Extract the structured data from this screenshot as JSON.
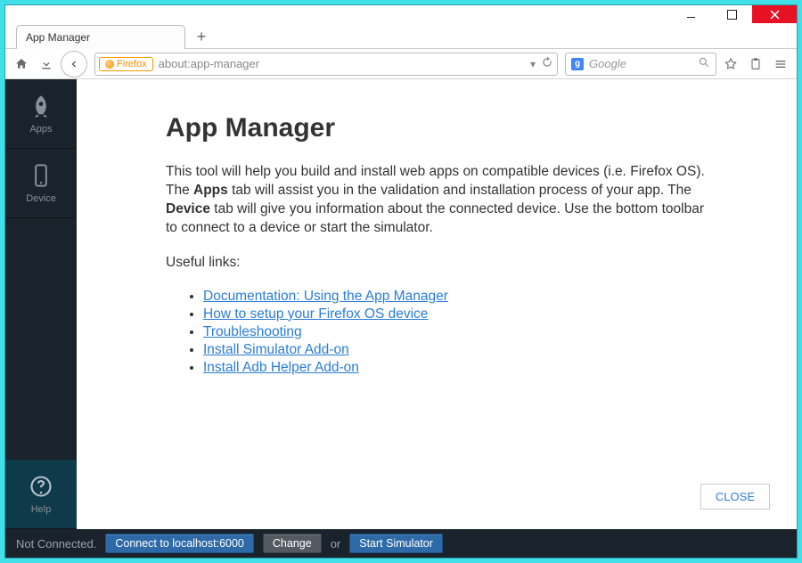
{
  "tab": {
    "title": "App Manager"
  },
  "url": {
    "identity": "Firefox",
    "address": "about:app-manager"
  },
  "search": {
    "placeholder": "Google"
  },
  "sidebar": {
    "apps": "Apps",
    "device": "Device",
    "help": "Help"
  },
  "page": {
    "title": "App Manager",
    "intro_1": "This tool will help you build and install web apps on compatible devices (i.e. Firefox OS). The ",
    "intro_apps": "Apps",
    "intro_2": " tab will assist you in the validation and installation process of your app. The ",
    "intro_device": "Device",
    "intro_3": " tab will give you information about the connected device. Use the bottom toolbar to connect to a device or start the simulator.",
    "useful": "Useful links:",
    "links": [
      "Documentation: Using the App Manager",
      "How to setup your Firefox OS device",
      "Troubleshooting",
      "Install Simulator Add-on",
      "Install Adb Helper Add-on"
    ],
    "close": "CLOSE"
  },
  "status": {
    "state": "Not Connected.",
    "connect": "Connect to localhost:6000",
    "change": "Change",
    "or": "or",
    "start": "Start Simulator"
  }
}
